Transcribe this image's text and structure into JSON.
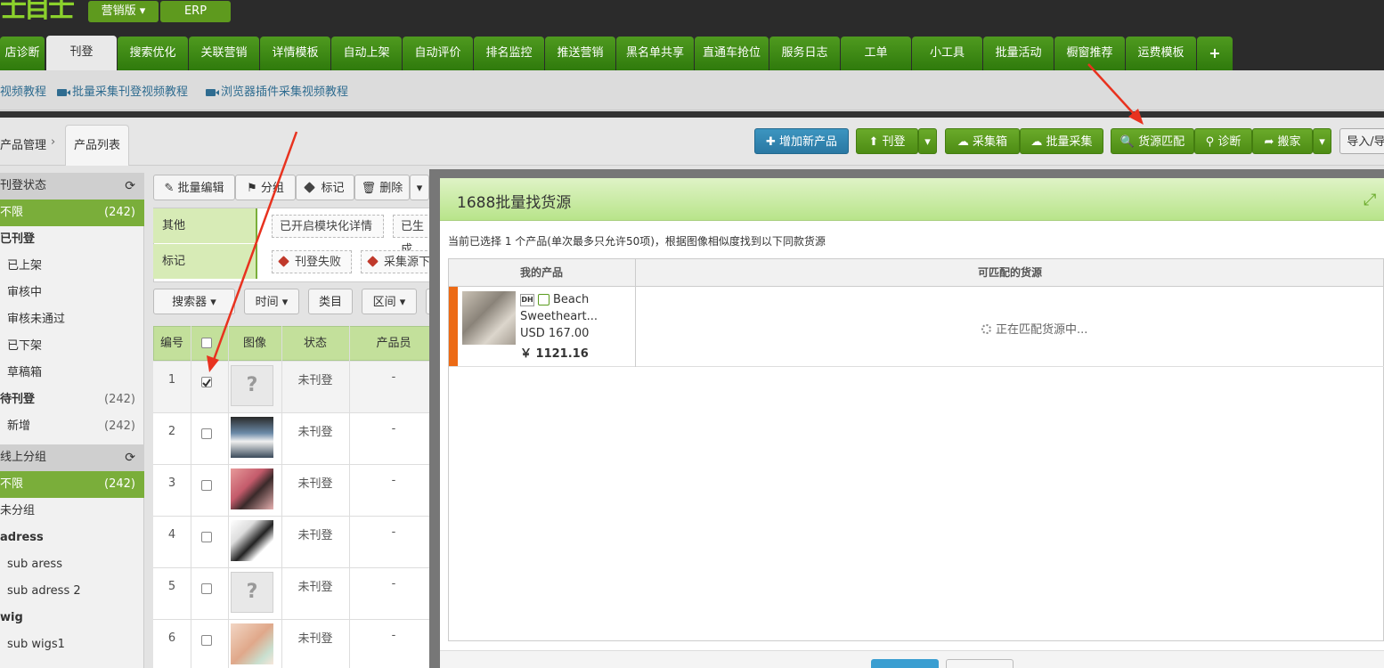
{
  "brand": {
    "logo_text": "士目士"
  },
  "topbar": {
    "marketing_label": "营销版 ▾",
    "erp_label": "ERP"
  },
  "nav": {
    "tabs": [
      {
        "label": "店诊断"
      },
      {
        "label": "刊登"
      },
      {
        "label": "搜索优化"
      },
      {
        "label": "关联营销"
      },
      {
        "label": "详情模板"
      },
      {
        "label": "自动上架"
      },
      {
        "label": "自动评价"
      },
      {
        "label": "排名监控"
      },
      {
        "label": "推送营销"
      },
      {
        "label": "黑名单共享"
      },
      {
        "label": "直通车抢位"
      },
      {
        "label": "服务日志"
      },
      {
        "label": "工单"
      },
      {
        "label": "小工具"
      },
      {
        "label": "批量活动"
      },
      {
        "label": "橱窗推荐"
      },
      {
        "label": "运费模板"
      },
      {
        "label": "+"
      }
    ]
  },
  "videos": {
    "links": [
      {
        "label": "视频教程"
      },
      {
        "label": "批量采集刊登视频教程"
      },
      {
        "label": "浏览器插件采集视频教程"
      }
    ]
  },
  "breadcrumb": {
    "parent": "产品管理",
    "sep": "›",
    "current": "产品列表"
  },
  "toolbar": {
    "add_product": "✚ 增加新产品",
    "publish": "⬆ 刊登",
    "collect_box": "☁ 采集箱",
    "batch_collect": "☁ 批量采集",
    "source_match": "🔍 货源匹配",
    "diagnose": "⚲ 诊断",
    "move": "➦ 搬家",
    "import": "导入/导",
    "caret": "▾"
  },
  "sidebar": {
    "status_header": "刊登状态",
    "status_items": [
      {
        "label": "不限",
        "count": "(242)"
      },
      {
        "label": "已刊登",
        "count": ""
      },
      {
        "label": "已上架",
        "count": ""
      },
      {
        "label": "审核中",
        "count": ""
      },
      {
        "label": "审核未通过",
        "count": ""
      },
      {
        "label": "已下架",
        "count": ""
      },
      {
        "label": "草稿箱",
        "count": ""
      },
      {
        "label": "待刊登",
        "count": "(242)"
      },
      {
        "label": "新增",
        "count": "(242)"
      }
    ],
    "group_header": "线上分组",
    "group_items": [
      {
        "label": "不限",
        "count": "(242)"
      },
      {
        "label": "未分组"
      },
      {
        "label": "adress"
      },
      {
        "label": "sub aress"
      },
      {
        "label": "sub adress 2"
      },
      {
        "label": "wig"
      },
      {
        "label": "sub wigs1"
      }
    ]
  },
  "content": {
    "actions": {
      "batch_edit": "✎ 批量编辑",
      "group": "⚑ 分组",
      "mark": "标记",
      "delete": "🗑 删除",
      "caret": "▾"
    },
    "filter": {
      "other_label": "其他",
      "tag_modular": "已开启模块化详情",
      "tag_generated": "已生成",
      "mark_label": "标记",
      "tag_fail": "刊登失败",
      "tag_source": "采集源下架"
    },
    "search": {
      "searcher": "搜索器 ▾",
      "time": "时间 ▾",
      "category": "类目",
      "range": "区间 ▾"
    },
    "table": {
      "headers": [
        "编号",
        "",
        "图像",
        "状态",
        "产品员"
      ],
      "rows": [
        {
          "no": "1",
          "status": "未刊登",
          "staff": "-",
          "img": "?"
        },
        {
          "no": "2",
          "status": "未刊登",
          "staff": "-",
          "img": ""
        },
        {
          "no": "3",
          "status": "未刊登",
          "staff": "-",
          "img": ""
        },
        {
          "no": "4",
          "status": "未刊登",
          "staff": "-",
          "img": ""
        },
        {
          "no": "5",
          "status": "未刊登",
          "staff": "-",
          "img": "?"
        },
        {
          "no": "6",
          "status": "未刊登",
          "staff": "-",
          "img": ""
        }
      ]
    }
  },
  "modal": {
    "title": "1688批量找货源",
    "info": "当前已选择 1 个产品(单次最多只允许50项)，根据图像相似度找到以下同款货源",
    "col_my_product": "我的产品",
    "col_sources": "可匹配的货源",
    "product": {
      "badge": "DH",
      "name_line1": "Beach",
      "name_line2": "Sweetheart...",
      "usd": "USD 167.00",
      "cny": "￥ 1121.16"
    },
    "loading": "正在匹配货源中..."
  },
  "colors": {
    "accent_green": "#4d8c14",
    "nav_green": "#3f8a16",
    "modal_header": "#c8ec9f",
    "orange": "#ec6a15",
    "arrow_red": "#e8321f"
  }
}
